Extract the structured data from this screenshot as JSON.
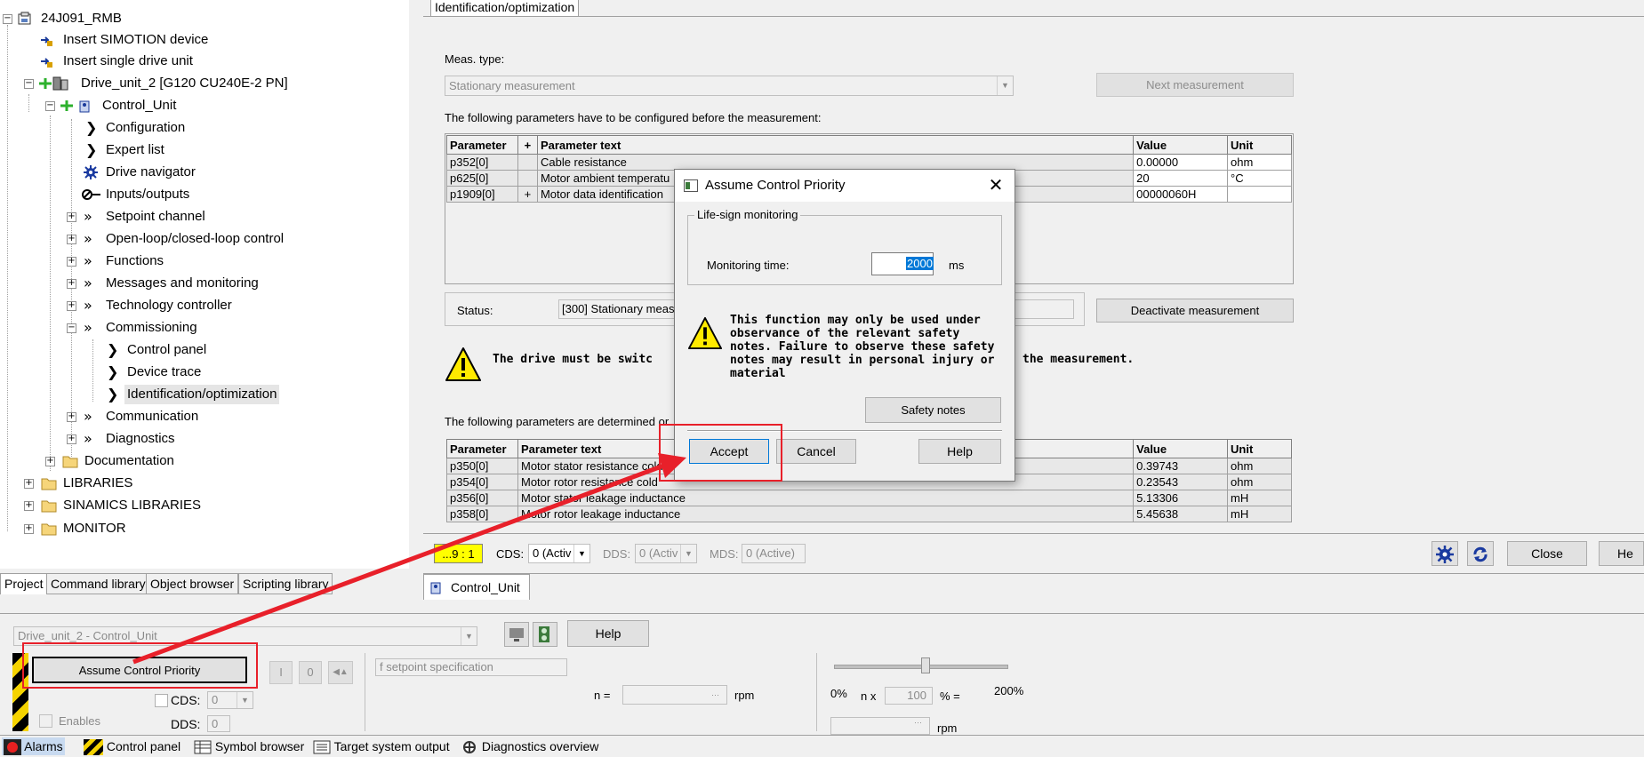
{
  "tree": {
    "root": "24J091_RMB",
    "insert_simotion": "Insert SIMOTION device",
    "insert_single": "Insert single drive unit",
    "drive_unit": "Drive_unit_2 [G120 CU240E-2 PN]",
    "control_unit": "Control_Unit",
    "configuration": "Configuration",
    "expert_list": "Expert list",
    "drive_navigator": "Drive navigator",
    "inputs_outputs": "Inputs/outputs",
    "setpoint_channel": "Setpoint channel",
    "open_loop": "Open-loop/closed-loop control",
    "functions": "Functions",
    "messages": "Messages and monitoring",
    "technology": "Technology controller",
    "commissioning": "Commissioning",
    "control_panel": "Control panel",
    "device_trace": "Device trace",
    "ident_opt": "Identification/optimization",
    "communication": "Communication",
    "diagnostics": "Diagnostics",
    "documentation": "Documentation",
    "libraries": "LIBRARIES",
    "sinamics_libraries": "SINAMICS LIBRARIES",
    "monitor": "MONITOR"
  },
  "left_tabs": [
    "Project",
    "Command library",
    "Object browser",
    "Scripting library"
  ],
  "main": {
    "tab_label": "Identification/optimization",
    "meas_type_label": "Meas. type:",
    "meas_type_value": "Stationary measurement",
    "next_measurement": "Next measurement",
    "config_intro": "The following parameters have to be configured before the measurement:",
    "config_headers": [
      "Parameter",
      "+",
      "Parameter text",
      "Value",
      "Unit"
    ],
    "config_rows": [
      [
        "p352[0]",
        "",
        "Cable resistance",
        "0.00000",
        "ohm"
      ],
      [
        "p625[0]",
        "",
        "Motor ambient temperatu",
        "20",
        "°C"
      ],
      [
        "p1909[0]",
        "+",
        "Motor data identification",
        "00000060H",
        ""
      ]
    ],
    "status_label": "Status:",
    "status_value": "[300] Stationary meas",
    "deactivate": "Deactivate measurement",
    "warning_left": "The drive must be switc",
    "warning_right": "the measurement.",
    "determined_intro": "The following parameters are determined or",
    "result_headers": [
      "Parameter",
      "Parameter text",
      "Value",
      "Unit"
    ],
    "result_rows": [
      [
        "p350[0]",
        "Motor stator resistance cold",
        "0.39743",
        "ohm"
      ],
      [
        "p354[0]",
        "Motor rotor resistance cold",
        "0.23543",
        "ohm"
      ],
      [
        "p356[0]",
        "Motor stator leakage inductance",
        "5.13306",
        "mH"
      ],
      [
        "p358[0]",
        "Motor rotor leakage inductance",
        "5.45638",
        "mH"
      ]
    ],
    "highlight_badge": "...9 : 1",
    "cds_label": "CDS:",
    "cds_value": "0 (Activ",
    "dds_label": "DDS:",
    "dds_value": "0 (Activ",
    "mds_label": "MDS:",
    "mds_value": "0 (Active)",
    "close": "Close",
    "help_partial": "He",
    "editor_tab": "Control_Unit"
  },
  "dialog": {
    "title": "Assume Control Priority",
    "group_label": "Life-sign monitoring",
    "monitoring_label": "Monitoring time:",
    "monitoring_value": "2000",
    "unit": "ms",
    "warning_text": "This function may only be used under observance of the relevant safety notes. Failure to observe these safety notes may result in personal injury or material",
    "safety_notes": "Safety notes",
    "accept": "Accept",
    "cancel": "Cancel",
    "help": "Help"
  },
  "cpanel": {
    "drive_select": "Drive_unit_2 - Control_Unit",
    "help": "Help",
    "assume_btn": "Assume Control Priority",
    "btn_i": "I",
    "btn_o": "0",
    "setpoint_spec": "f setpoint specification",
    "n_label": "n =",
    "rpm": "rpm",
    "rpm2": "rpm",
    "pct0": "0%",
    "nx_label": "n x",
    "nx_value": "100",
    "pct_eq": "% =",
    "pct200": "200%",
    "cds_label": "CDS:",
    "cds_value": "0",
    "dds_label": "DDS:",
    "dds_value": "0",
    "enables": "Enables"
  },
  "statusbar": [
    "Alarms",
    "Control panel",
    "Symbol browser",
    "Target system output",
    "Diagnostics overview"
  ],
  "colors": {
    "annotation": "#e8202a",
    "badge": "#ffff00",
    "selection": "#0078d7"
  }
}
